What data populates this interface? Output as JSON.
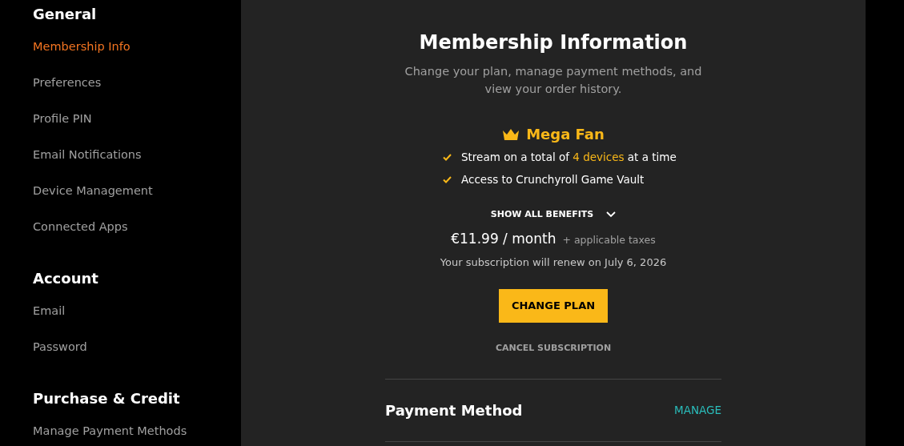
{
  "sidebar": {
    "sections": [
      {
        "title": "General",
        "items": [
          {
            "label": "Membership Info",
            "selected": true
          },
          {
            "label": "Preferences",
            "selected": false
          },
          {
            "label": "Profile PIN",
            "selected": false
          },
          {
            "label": "Email Notifications",
            "selected": false
          },
          {
            "label": "Device Management",
            "selected": false
          },
          {
            "label": "Connected Apps",
            "selected": false
          }
        ]
      },
      {
        "title": "Account",
        "items": [
          {
            "label": "Email",
            "selected": false
          },
          {
            "label": "Password",
            "selected": false
          }
        ]
      },
      {
        "title": "Purchase & Credit",
        "items": [
          {
            "label": "Manage Payment Methods",
            "selected": false
          }
        ]
      }
    ]
  },
  "membership": {
    "title": "Membership Information",
    "subtitle": "Change your plan, manage payment methods, and view your order history.",
    "plan": {
      "name": "Mega Fan",
      "benefits": [
        {
          "parts": [
            {
              "text": "Stream on a total of ",
              "highlight": false
            },
            {
              "text": "4 devices",
              "highlight": true
            },
            {
              "text": " at a time",
              "highlight": false
            }
          ]
        },
        {
          "parts": [
            {
              "text": "Access to Crunchyroll Game Vault",
              "highlight": false
            }
          ]
        }
      ]
    },
    "show_all": {
      "label": "SHOW ALL BENEFITS",
      "expanded": false
    },
    "price": "€11.99 / month",
    "taxes": "+ applicable taxes",
    "renewal": "Your subscription will renew on July 6, 2026",
    "change_button": "CHANGE PLAN",
    "cancel_link": "CANCEL SUBSCRIPTION"
  },
  "payment": {
    "title": "Payment Method",
    "action": "MANAGE"
  }
}
